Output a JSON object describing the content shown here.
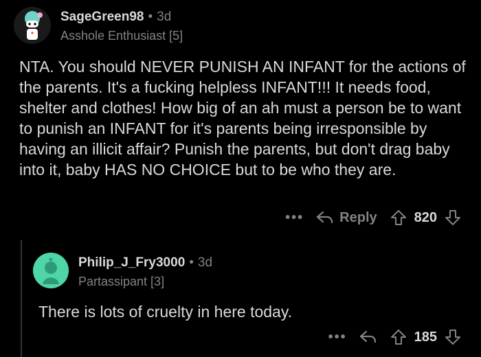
{
  "top_comment": {
    "username": "SageGreen98",
    "separator": "•",
    "age": "3d",
    "flair": "Asshole Enthusiast [5]",
    "body": "NTA. You should NEVER PUNISH AN INFANT for the actions of the parents. It's a fucking helpless INFANT!!! It needs food, shelter and clothes! How big of an ah must a person be to want to punish an INFANT for it's parents being irresponsible by having an illicit affair? Punish the parents, but don't drag baby into it, baby HAS NO CHOICE but to be who they are.",
    "actions": {
      "more": "•••",
      "reply_label": "Reply",
      "score": "820"
    }
  },
  "reply_comment": {
    "username": "Philip_J_Fry3000",
    "separator": "•",
    "age": "3d",
    "flair": "Partassipant [3]",
    "body": "There is lots of cruelty in here today.",
    "actions": {
      "more": "•••",
      "score": "185"
    }
  },
  "colors": {
    "background": "#000000",
    "text_primary": "#d7dadc",
    "text_secondary": "#818384",
    "thread_line": "#343536",
    "reply_avatar_bg": "#4fd6a6"
  },
  "icons": {
    "top_avatar": "snoo-avatar-icon",
    "reply_avatar": "snoo-avatar-icon",
    "reply": "reply-arrow-icon",
    "upvote": "upvote-icon",
    "downvote": "downvote-icon"
  }
}
